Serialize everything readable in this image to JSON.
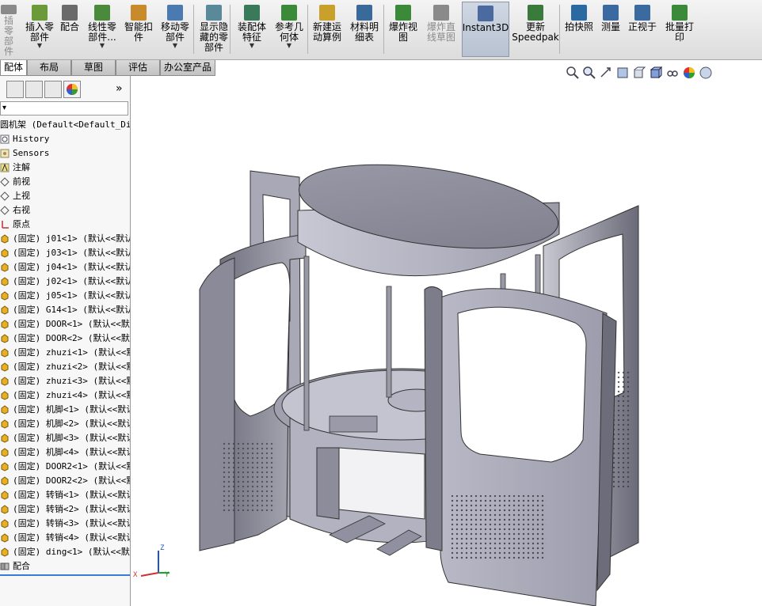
{
  "toolbar": {
    "items": [
      {
        "label": "插零\n部件",
        "disabled": true
      },
      {
        "label": "插入零\n部件",
        "arrow": true
      },
      {
        "label": "配合"
      },
      {
        "label": "线性零\n部件...",
        "arrow": true
      },
      {
        "label": "智能扣\n件"
      },
      {
        "label": "移动零\n部件",
        "arrow": true
      },
      {
        "label": "显示隐\n藏的零\n部件"
      },
      {
        "label": "装配体\n特征",
        "arrow": true
      },
      {
        "label": "参考几\n何体",
        "arrow": true
      },
      {
        "label": "新建运\n动算例"
      },
      {
        "label": "材料明\n细表"
      },
      {
        "label": "爆炸视\n图"
      },
      {
        "label": "爆炸直\n线草图",
        "disabled": true
      },
      {
        "label": "Instant3D",
        "active": true
      },
      {
        "label": "更新\nSpeedpak"
      },
      {
        "label": "拍快照"
      },
      {
        "label": "测量"
      },
      {
        "label": "正视于"
      },
      {
        "label": "批量打\n印"
      }
    ]
  },
  "tabs": [
    "配体",
    "布局",
    "草图",
    "评估",
    "办公室产品"
  ],
  "featuremanager": {
    "collapse_glyph": "»",
    "filter_arrow": "▾",
    "root": "圆机架  (Default<Default_Dis",
    "nodes": [
      {
        "label": "History",
        "icon": "history-icon"
      },
      {
        "label": "Sensors",
        "icon": "sensors-icon"
      },
      {
        "label": "注解",
        "icon": "annotations-icon"
      },
      {
        "label": "前视",
        "icon": "plane-icon"
      },
      {
        "label": "上视",
        "icon": "plane-icon"
      },
      {
        "label": "右视",
        "icon": "plane-icon"
      },
      {
        "label": "原点",
        "icon": "origin-icon"
      },
      {
        "label": "(固定) j01<1> (默认<<默认",
        "icon": "part-icon"
      },
      {
        "label": "(固定) j03<1> (默认<<默认",
        "icon": "part-icon"
      },
      {
        "label": "(固定) j04<1> (默认<<默认",
        "icon": "part-icon"
      },
      {
        "label": "(固定) j02<1> (默认<<默认",
        "icon": "part-icon"
      },
      {
        "label": "(固定) j05<1> (默认<<默认",
        "icon": "part-icon"
      },
      {
        "label": "(固定) G14<1> (默认<<默认",
        "icon": "part-icon"
      },
      {
        "label": "(固定) DOOR<1> (默认<<默",
        "icon": "part-icon"
      },
      {
        "label": "(固定) DOOR<2> (默认<<默",
        "icon": "part-icon"
      },
      {
        "label": "(固定) zhuzi<1> (默认<<默",
        "icon": "part-icon"
      },
      {
        "label": "(固定) zhuzi<2> (默认<<默",
        "icon": "part-icon"
      },
      {
        "label": "(固定) zhuzi<3> (默认<<默",
        "icon": "part-icon"
      },
      {
        "label": "(固定) zhuzi<4> (默认<<默",
        "icon": "part-icon"
      },
      {
        "label": "(固定) 机脚<1> (默认<<默认",
        "icon": "part-icon"
      },
      {
        "label": "(固定) 机脚<2> (默认<<默认",
        "icon": "part-icon"
      },
      {
        "label": "(固定) 机脚<3> (默认<<默认",
        "icon": "part-icon"
      },
      {
        "label": "(固定) 机脚<4> (默认<<默认",
        "icon": "part-icon"
      },
      {
        "label": "(固定) DOOR2<1> (默认<<默",
        "icon": "part-icon"
      },
      {
        "label": "(固定) DOOR2<2> (默认<<默",
        "icon": "part-icon"
      },
      {
        "label": "(固定) 转销<1> (默认<<默认",
        "icon": "part-icon"
      },
      {
        "label": "(固定) 转销<2> (默认<<默认",
        "icon": "part-icon"
      },
      {
        "label": "(固定) 转销<3> (默认<<默认",
        "icon": "part-icon"
      },
      {
        "label": "(固定) 转销<4> (默认<<默认",
        "icon": "part-icon"
      },
      {
        "label": "(固定) ding<1> (默认<<默认",
        "icon": "part-icon"
      },
      {
        "label": "配合",
        "icon": "mates-icon"
      }
    ]
  },
  "triad": {
    "x": "X",
    "y": "Y",
    "z": "Z"
  },
  "colors": {
    "part": "#c0c0cc",
    "part_dark": "#7a7a88",
    "accent": "#2060c0",
    "panel": "#f7f7f7"
  }
}
